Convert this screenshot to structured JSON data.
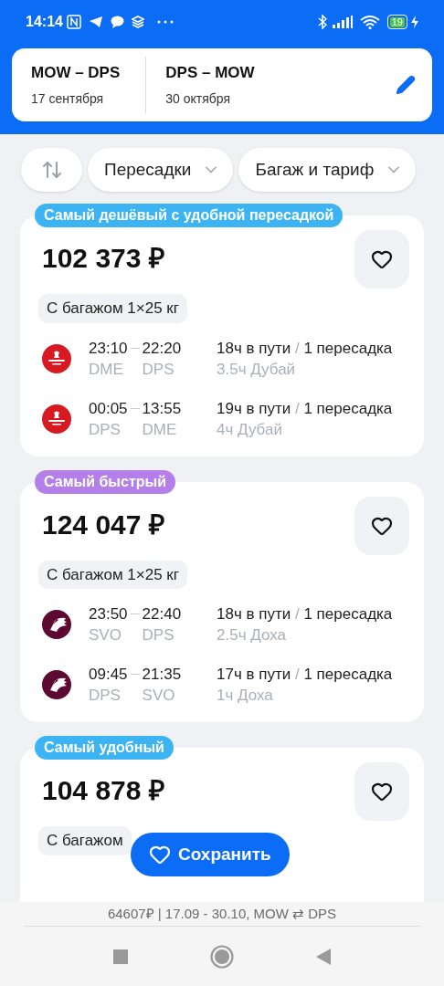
{
  "status_bar": {
    "time": "14:14",
    "battery": "19"
  },
  "search": {
    "legs": [
      {
        "route": "MOW – DPS",
        "date": "17 сентября"
      },
      {
        "route": "DPS – MOW",
        "date": "30 октября"
      }
    ]
  },
  "filters": [
    {
      "kind": "sort"
    },
    {
      "kind": "dropdown",
      "label": "Пересадки"
    },
    {
      "kind": "dropdown",
      "label": "Багаж и тариф"
    }
  ],
  "offers": [
    {
      "badge": "Самый дешёвый с удобной пересадкой",
      "color": "#3cb4f4",
      "price": "102 373 ₽",
      "baggage": "С багажом 1×25 кг",
      "flights": [
        {
          "kind": "emirates",
          "depart": "23:10",
          "arrive": "22:20",
          "from": "DME",
          "to": "DPS",
          "duration": "18ч в пути",
          "separator": "/",
          "stops": "1 пересадка",
          "layover": "3.5ч Дубай"
        },
        {
          "kind": "emirates",
          "depart": "00:05",
          "arrive": "13:55",
          "from": "DPS",
          "to": "DME",
          "duration": "19ч в пути",
          "separator": "/",
          "stops": "1 пересадка",
          "layover": "4ч Дубай"
        }
      ]
    },
    {
      "badge": "Самый быстрый",
      "color": "#b47fe9",
      "price": "124 047 ₽",
      "baggage": "С багажом 1×25 кг",
      "flights": [
        {
          "kind": "qatar",
          "depart": "23:50",
          "arrive": "22:40",
          "from": "SVO",
          "to": "DPS",
          "duration": "18ч в пути",
          "separator": "/",
          "stops": "1 пересадка",
          "layover": "2.5ч Доха"
        },
        {
          "kind": "qatar",
          "depart": "09:45",
          "arrive": "21:35",
          "from": "DPS",
          "to": "SVO",
          "duration": "17ч в пути",
          "separator": "/",
          "stops": "1 пересадка",
          "layover": "1ч Доха"
        }
      ]
    },
    {
      "badge": "Самый удобный",
      "color": "#3cb4f4",
      "price": "104 878 ₽",
      "baggage": "С багажом"
    }
  ],
  "save_button": {
    "label": "Сохранить"
  },
  "summary": "64607₽ | 17.09 - 30.10, MOW ⇄ DPS"
}
